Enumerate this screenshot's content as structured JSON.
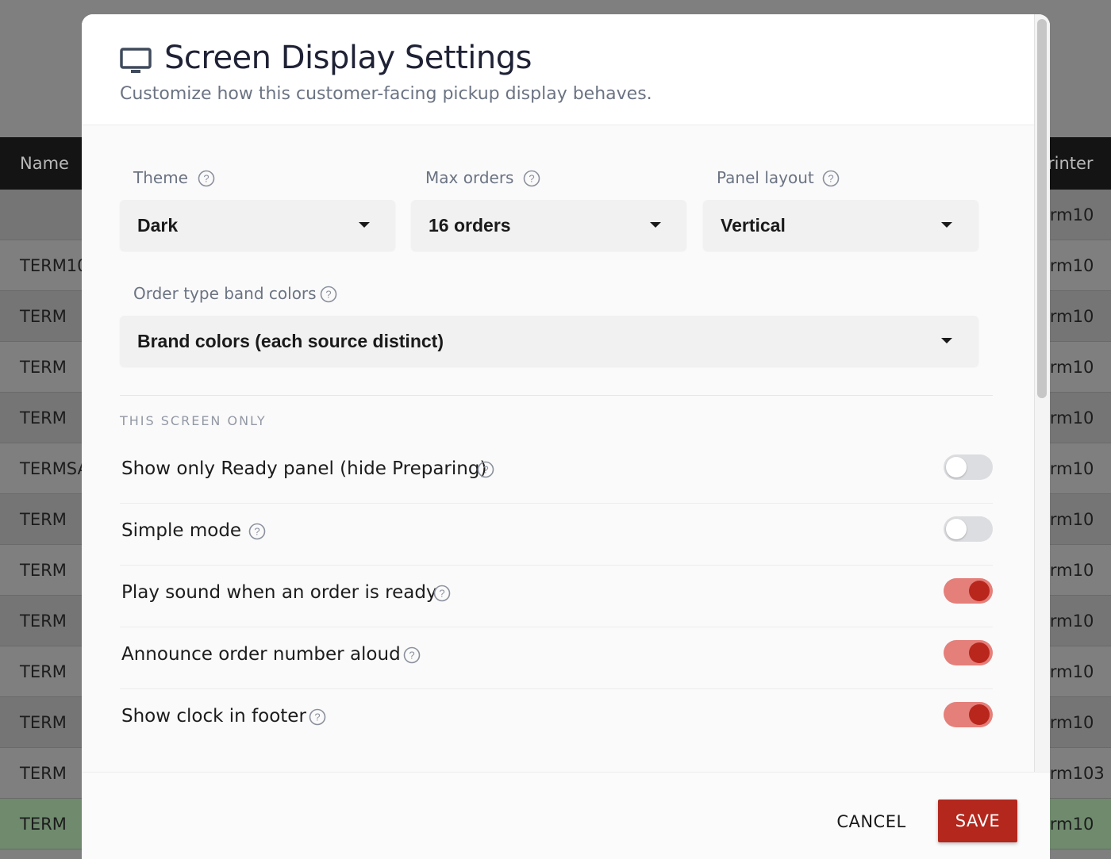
{
  "background_table": {
    "header": {
      "name": "Name",
      "printer": "rinter"
    },
    "rows": [
      {
        "name": "",
        "printer": "erm10"
      },
      {
        "name": "TERM10",
        "printer": "erm10"
      },
      {
        "name": "TERM",
        "printer": "erm10"
      },
      {
        "name": "TERM",
        "printer": "erm10"
      },
      {
        "name": "TERM",
        "printer": "erm10"
      },
      {
        "name": "TERMSA",
        "printer": "erm10"
      },
      {
        "name": "TERM",
        "printer": "erm10"
      },
      {
        "name": "TERM",
        "printer": "erm10"
      },
      {
        "name": "TERM",
        "printer": "erm10"
      },
      {
        "name": "TERM",
        "printer": "erm10"
      },
      {
        "name": "TERM",
        "printer": "erm10"
      },
      {
        "name": "TERM",
        "printer": "erm103"
      },
      {
        "name": "TERM",
        "printer": "erm10"
      }
    ]
  },
  "modal": {
    "icon": "monitor-icon",
    "title": "Screen Display Settings",
    "subtitle": "Customize how this customer-facing pickup display behaves.",
    "fields": {
      "theme": {
        "label": "Theme",
        "value": "Dark"
      },
      "max_orders": {
        "label": "Max orders",
        "value": "16 orders"
      },
      "panel_layout": {
        "label": "Panel layout",
        "value": "Vertical"
      },
      "band_colors": {
        "label": "Order type band colors",
        "value": "Brand colors (each source distinct)"
      }
    },
    "section_label": "THIS SCREEN ONLY",
    "settings": [
      {
        "label": "Show only Ready panel (hide Preparing)",
        "on": false
      },
      {
        "label": "Simple mode",
        "on": false
      },
      {
        "label": "Play sound when an order is ready",
        "on": true
      },
      {
        "label": "Announce order number aloud",
        "on": true
      },
      {
        "label": "Show clock in footer",
        "on": true
      }
    ],
    "buttons": {
      "cancel": "CANCEL",
      "save": "SAVE"
    }
  },
  "colors": {
    "accent": "#b3271d",
    "toggle_on_track": "#e57f7a",
    "toggle_off_track": "#dcdde0"
  }
}
